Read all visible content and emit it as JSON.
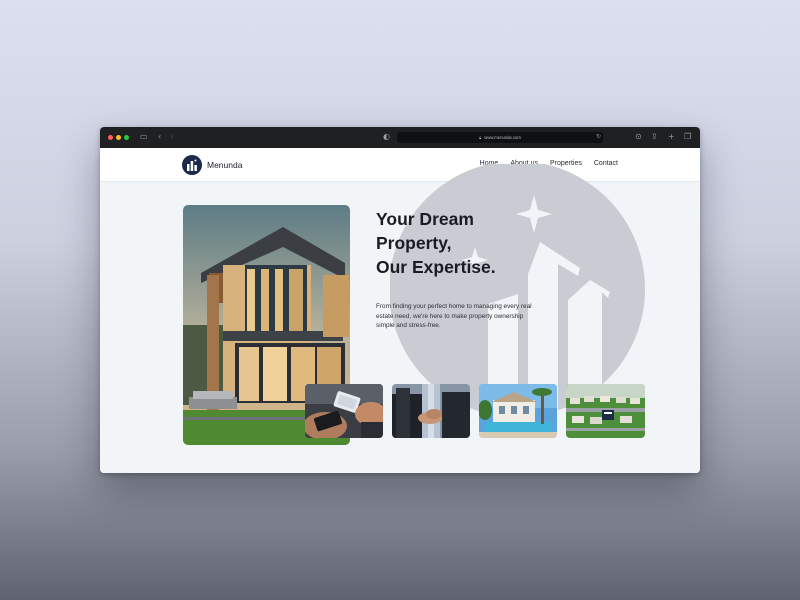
{
  "browser": {
    "url": "www.menunda.com"
  },
  "site": {
    "brand": "Menunda",
    "nav": [
      {
        "label": "Home",
        "active": true
      },
      {
        "label": "About us",
        "active": false
      },
      {
        "label": "Properties",
        "active": false
      },
      {
        "label": "Contact",
        "active": false
      }
    ],
    "hero": {
      "headline": [
        "Your Dream",
        "Property,",
        "Our Expertise."
      ],
      "description": "From finding your perfect home to managing every real estate need, we're here to make property ownership simple and stress-free."
    }
  },
  "colors": {
    "brand_navy": "#1c2a4a",
    "emblem_gray": "#c9ccd2",
    "page_bg": "#f2f5f8"
  }
}
